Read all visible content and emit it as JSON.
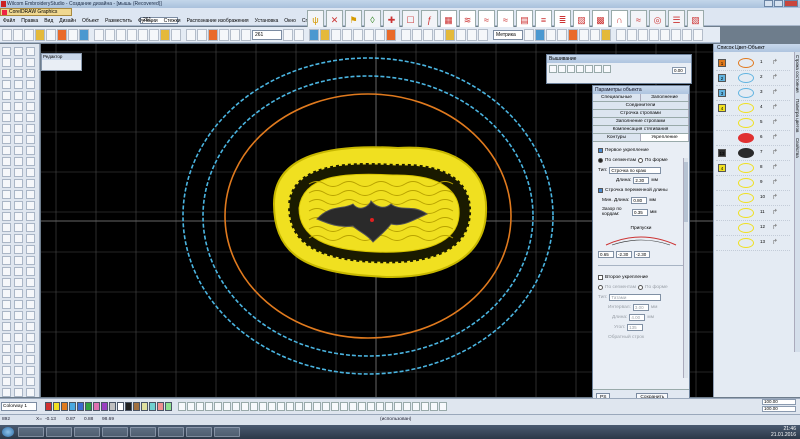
{
  "window": {
    "title": "Wilcom EmbroideryStudio - Создание дизайна - [мышь (Recovered)]"
  },
  "appmenu": {
    "label": "CorelDRAW Graphics"
  },
  "design_combo": "261",
  "menus": [
    "Файл",
    "Правка",
    "Вид",
    "Дизайн",
    "Объект",
    "Разместить",
    "Функции",
    "Стежки",
    "Распознание изображения",
    "Установка",
    "Окно",
    "Справка"
  ],
  "toolbar": {
    "zoom_value": "261",
    "color_label": "Метрика"
  },
  "edit_panel": {
    "title": "Редактор"
  },
  "stitch_window": {
    "title": "Вышивание",
    "value": "0.00"
  },
  "object_params": {
    "title": "Параметры объекта",
    "tabs_top": [
      "Специальные",
      "Заполнение"
    ],
    "sections": [
      "Соединители",
      "Строчка стропами",
      "Заполнение стропами",
      "Компенсация стягивания"
    ],
    "tabs_bottom": [
      "Контуры",
      "Укрепление"
    ],
    "first_underlay": "Первое укрепление",
    "by_segment": "По сегментам",
    "by_shape": "По форме",
    "type_label": "Тип:",
    "type_value": "Строчка по краю",
    "length_label": "Длина:",
    "length_value": "2.30",
    "unit": "мм",
    "variable_run": "Строчка переменной длины",
    "min_length_label": "Мин. Длина:",
    "min_length_value": "0.80",
    "gap_label": "Зазор по кордам:",
    "gap_value": "0.35",
    "allowances_label": "Припуски",
    "allowances": [
      "0.65",
      "-2.30",
      "-2.30"
    ],
    "second_underlay": "Второе укрепление",
    "type2_value": "Татами",
    "interval_label": "Интервал:",
    "interval_value": "3.00",
    "length2_label": "Длина:",
    "length2_value": "4.00",
    "angle_label": "Угол:",
    "angle_value": "135",
    "reverse_label": "Обратный строк",
    "footer_left": "PS",
    "footer_save": "Сохранить"
  },
  "right_panel": {
    "title": "Список Цвет-Объект",
    "side_tabs": [
      "Строка состояния",
      "Палитра цветов",
      "Свойства"
    ],
    "objects": [
      {
        "num": "1",
        "color": "#e07a1e",
        "idx": "1"
      },
      {
        "num": "2",
        "color": "#62b4e0",
        "idx": "2"
      },
      {
        "num": "3",
        "color": "#62b4e0",
        "idx": "3"
      },
      {
        "num": "4",
        "color": "#f0e020",
        "idx": "4"
      },
      {
        "num": "",
        "color": "#f0e020",
        "idx": "5"
      },
      {
        "num": "",
        "color": "#e03030",
        "idx": "6"
      },
      {
        "num": "13",
        "color": "#2a2a2a",
        "idx": "7"
      },
      {
        "num": "4",
        "color": "#f0e020",
        "idx": "8"
      },
      {
        "num": "",
        "color": "#f0e020",
        "idx": "9"
      },
      {
        "num": "",
        "color": "#f0e020",
        "idx": "10"
      },
      {
        "num": "",
        "color": "#f0e020",
        "idx": "11"
      },
      {
        "num": "",
        "color": "#f0e020",
        "idx": "12"
      },
      {
        "num": "",
        "color": "#f0e020",
        "idx": "13"
      }
    ]
  },
  "palette": {
    "name": "Colorway 1",
    "swatches": [
      "#d03030",
      "#f0e020",
      "#e07a1e",
      "#4aa8e0",
      "#3a6ad0",
      "#30a040",
      "#e070b0",
      "#9a40c0",
      "#c0c0c0",
      "#ffffff",
      "#202020",
      "#a07040",
      "#e0e0a0",
      "#70d0d0",
      "#f09090",
      "#90e090"
    ],
    "labels": [
      "1",
      "2",
      "3",
      "4",
      "5",
      "6",
      "7",
      "8",
      "9",
      "10",
      "11",
      "12",
      "13",
      "14",
      "15",
      "16"
    ],
    "right_vals": [
      "100.00",
      "100.00"
    ]
  },
  "status": {
    "left": "892",
    "x_label": "X=",
    "x_value": "-0.13",
    "y_value": "0.87",
    "l_value": "0.88",
    "a_value": "98.69",
    "center": "(использован)"
  },
  "clock": {
    "time": "21:46",
    "date": "21.01.2016"
  },
  "canvas_colors": {
    "bg": "#000000",
    "grid": "#4a4a4a",
    "blue_ring": "#4ab4e0",
    "orange_ring": "#e07a1e",
    "yellow": "#f0e020",
    "dark": "#2a2a2a"
  }
}
